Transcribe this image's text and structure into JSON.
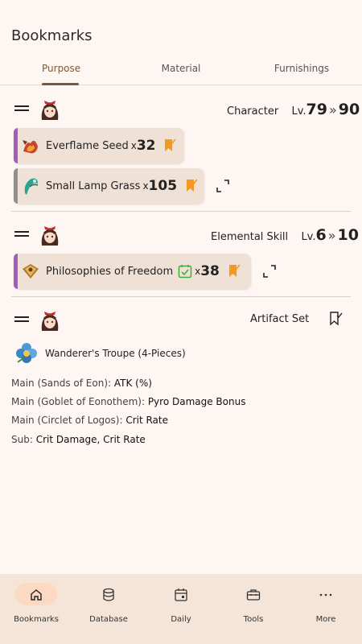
{
  "header": {
    "title": "Bookmarks"
  },
  "tabs": [
    {
      "label": "Purpose",
      "active": true
    },
    {
      "label": "Material",
      "active": false
    },
    {
      "label": "Furnishings",
      "active": false
    }
  ],
  "sections": [
    {
      "type_label": "Character",
      "level": {
        "prefix": "Lv.",
        "from": "79",
        "to": "90"
      },
      "items": [
        {
          "name": "Everflame Seed",
          "x": "x",
          "qty": "32",
          "stripe": "#a35bc0"
        },
        {
          "name": "Small Lamp Grass",
          "x": "x",
          "qty": "105",
          "stripe": "#8f8f8f"
        }
      ]
    },
    {
      "type_label": "Elemental Skill",
      "level": {
        "prefix": "Lv.",
        "from": "6",
        "to": "10"
      },
      "items": [
        {
          "name": "Philosophies of Freedom",
          "x": "x",
          "qty": "38",
          "stripe": "#a35bc0"
        }
      ]
    },
    {
      "type_label": "Artifact Set",
      "artifact": {
        "name": "Wanderer's Troupe  (4-Pieces)"
      },
      "stats": [
        {
          "label": "Main (Sands of Eon): ",
          "value": "ATK (%)"
        },
        {
          "label": "Main (Goblet of Eonothem): ",
          "value": "Pyro Damage Bonus"
        },
        {
          "label": "Main (Circlet of Logos): ",
          "value": "Crit Rate"
        },
        {
          "label": "Sub: ",
          "value": "Crit Damage, Crit Rate"
        }
      ]
    }
  ],
  "nav": [
    {
      "label": "Bookmarks",
      "icon": "home-icon",
      "active": true
    },
    {
      "label": "Database",
      "icon": "database-icon",
      "active": false
    },
    {
      "label": "Daily",
      "icon": "calendar-icon",
      "active": false
    },
    {
      "label": "Tools",
      "icon": "toolbox-icon",
      "active": false
    },
    {
      "label": "More",
      "icon": "more-icon",
      "active": false
    }
  ],
  "colors": {
    "accent": "#7a5a34",
    "bookmark": "#f39a1e",
    "check": "#3fae3f",
    "nav_bg": "#f5e5d8",
    "nav_active": "#fbd9c2"
  }
}
